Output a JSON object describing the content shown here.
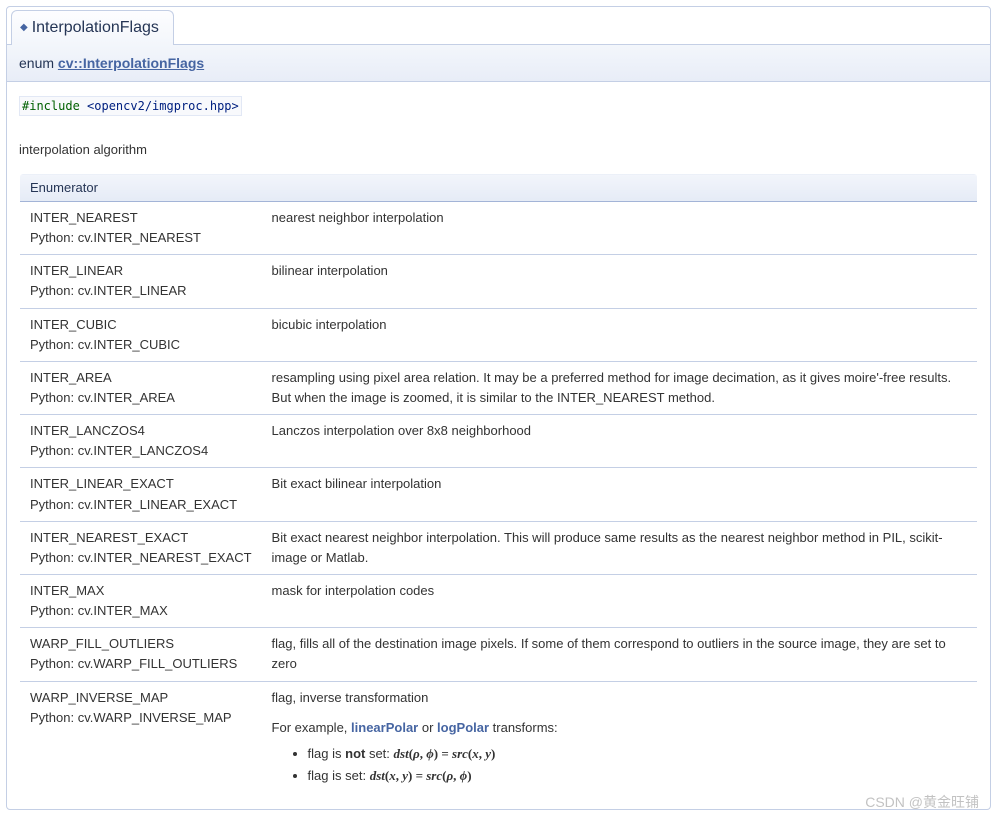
{
  "tab": {
    "title": "InterpolationFlags"
  },
  "header": {
    "prefix": "enum ",
    "link": "cv::InterpolationFlags"
  },
  "include": {
    "keyword": "#include",
    "path": "<opencv2/imgproc.hpp>"
  },
  "desc": "interpolation algorithm",
  "tableHeader": "Enumerator",
  "rows": [
    {
      "cpp": "INTER_NEAREST",
      "py": "Python: cv.INTER_NEAREST",
      "text": "nearest neighbor interpolation"
    },
    {
      "cpp": "INTER_LINEAR",
      "py": "Python: cv.INTER_LINEAR",
      "text": "bilinear interpolation"
    },
    {
      "cpp": "INTER_CUBIC",
      "py": "Python: cv.INTER_CUBIC",
      "text": "bicubic interpolation"
    },
    {
      "cpp": "INTER_AREA",
      "py": "Python: cv.INTER_AREA",
      "text": "resampling using pixel area relation. It may be a preferred method for image decimation, as it gives moire'-free results. But when the image is zoomed, it is similar to the INTER_NEAREST method."
    },
    {
      "cpp": "INTER_LANCZOS4",
      "py": "Python: cv.INTER_LANCZOS4",
      "text": "Lanczos interpolation over 8x8 neighborhood"
    },
    {
      "cpp": "INTER_LINEAR_EXACT",
      "py": "Python: cv.INTER_LINEAR_EXACT",
      "text": "Bit exact bilinear interpolation"
    },
    {
      "cpp": "INTER_NEAREST_EXACT",
      "py": "Python: cv.INTER_NEAREST_EXACT",
      "text": "Bit exact nearest neighbor interpolation. This will produce same results as the nearest neighbor method in PIL, scikit-image or Matlab."
    },
    {
      "cpp": "INTER_MAX",
      "py": "Python: cv.INTER_MAX",
      "text": "mask for interpolation codes"
    },
    {
      "cpp": "WARP_FILL_OUTLIERS",
      "py": "Python: cv.WARP_FILL_OUTLIERS",
      "text": "flag, fills all of the destination image pixels. If some of them correspond to outliers in the source image, they are set to zero"
    },
    {
      "cpp": "WARP_INVERSE_MAP",
      "py": "Python: cv.WARP_INVERSE_MAP",
      "para1": "flag, inverse transformation",
      "para2_prefix": "For example, ",
      "link1": "linearPolar",
      "para2_mid": " or ",
      "link2": "logPolar",
      "para2_suffix": " transforms:",
      "bullet1_prefix": "flag is ",
      "bullet1_strong": "not",
      "bullet1_mid": " set: ",
      "bullet1_math": "dst(ρ, ϕ) = src(x, y)",
      "bullet2_prefix": "flag is set: ",
      "bullet2_math": "dst(x, y) = src(ρ, ϕ)"
    }
  ],
  "watermark": "CSDN @黄金旺铺"
}
